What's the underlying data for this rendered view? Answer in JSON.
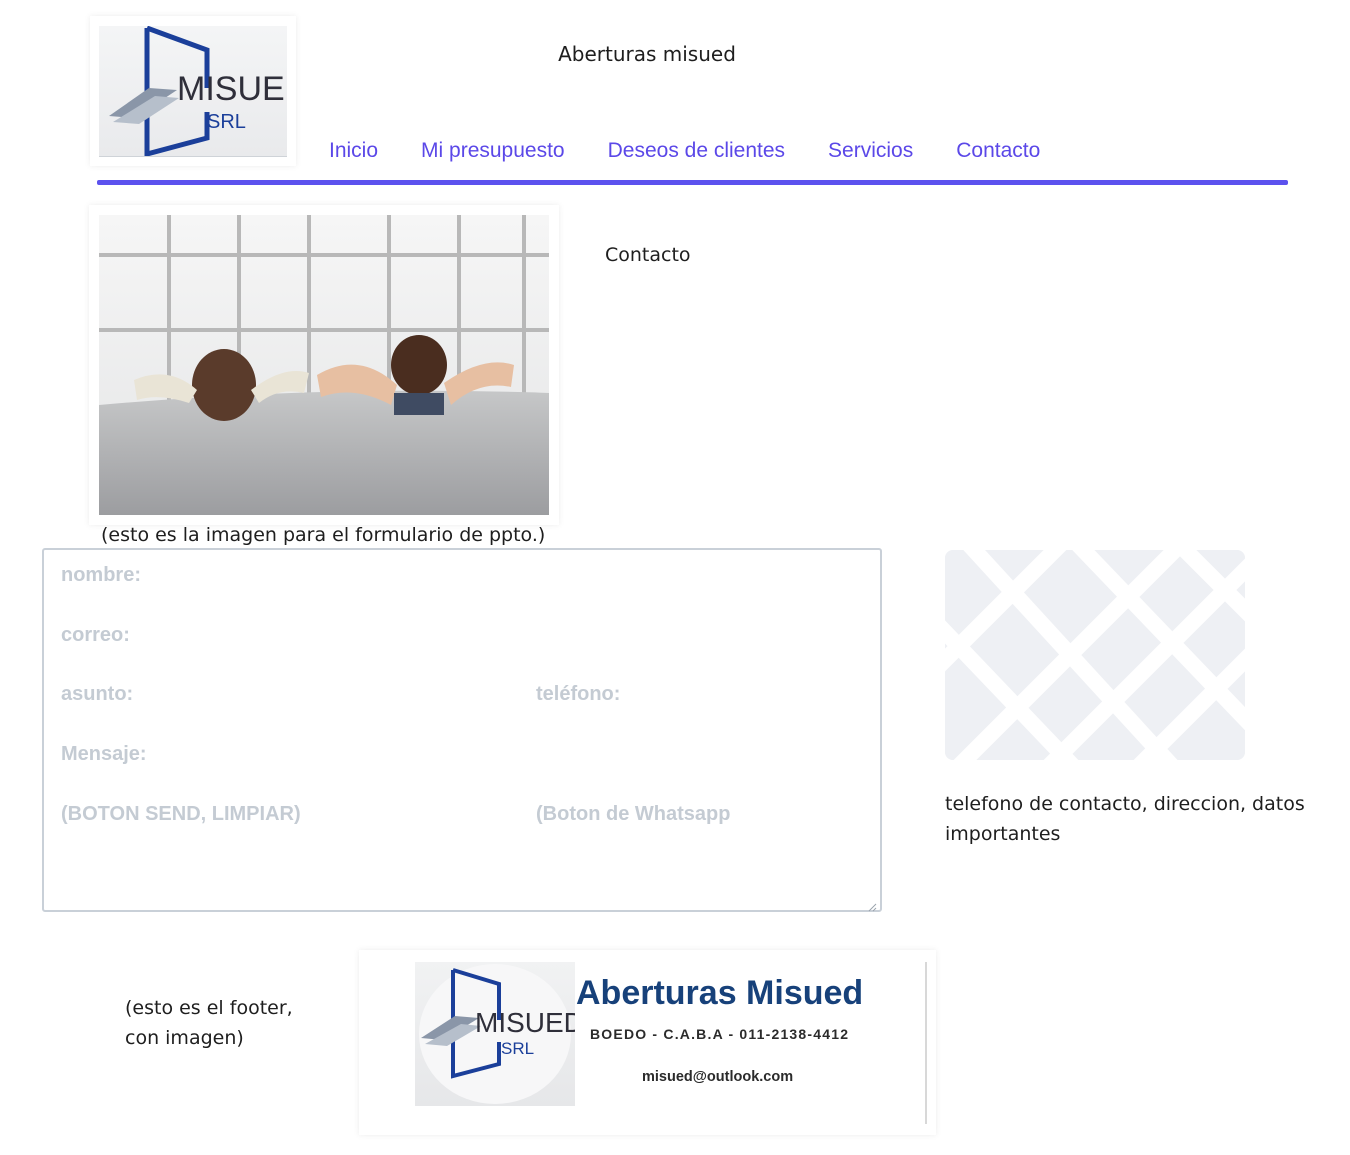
{
  "header": {
    "title": "Aberturas misued",
    "logo": {
      "brand": "MISUED",
      "sub": "SRL"
    }
  },
  "nav": {
    "items": [
      {
        "label": "Inicio"
      },
      {
        "label": "Mi presupuesto"
      },
      {
        "label": "Deseos de clientes"
      },
      {
        "label": "Servicios"
      },
      {
        "label": "Contacto"
      }
    ]
  },
  "colors": {
    "accent": "#5c52ee",
    "nav_link": "#5b48e8",
    "form_placeholder": "#c4cbd3",
    "brand_blue": "#17417a"
  },
  "main": {
    "heading": "Contacto",
    "image_caption": "(esto es la imagen para el formulario de ppto.)"
  },
  "form": {
    "nombre": "nombre:",
    "correo": "correo:",
    "asunto": "asunto:",
    "telefono": "teléfono:",
    "mensaje": "Mensaje:",
    "buttons": "(BOTON SEND, LIMPIAR)",
    "whatsapp": "(Boton de Whatsapp"
  },
  "sidebar": {
    "info": "telefono de contacto, direccion, datos importantes"
  },
  "footer": {
    "note": "(esto es el footer, con imagen)",
    "brand": "Aberturas Misued",
    "address": "BOEDO - C.A.B.A - 011-2138-4412",
    "email": "misued@outlook.com",
    "logo": {
      "brand": "MISUED",
      "sub": "SRL"
    }
  }
}
